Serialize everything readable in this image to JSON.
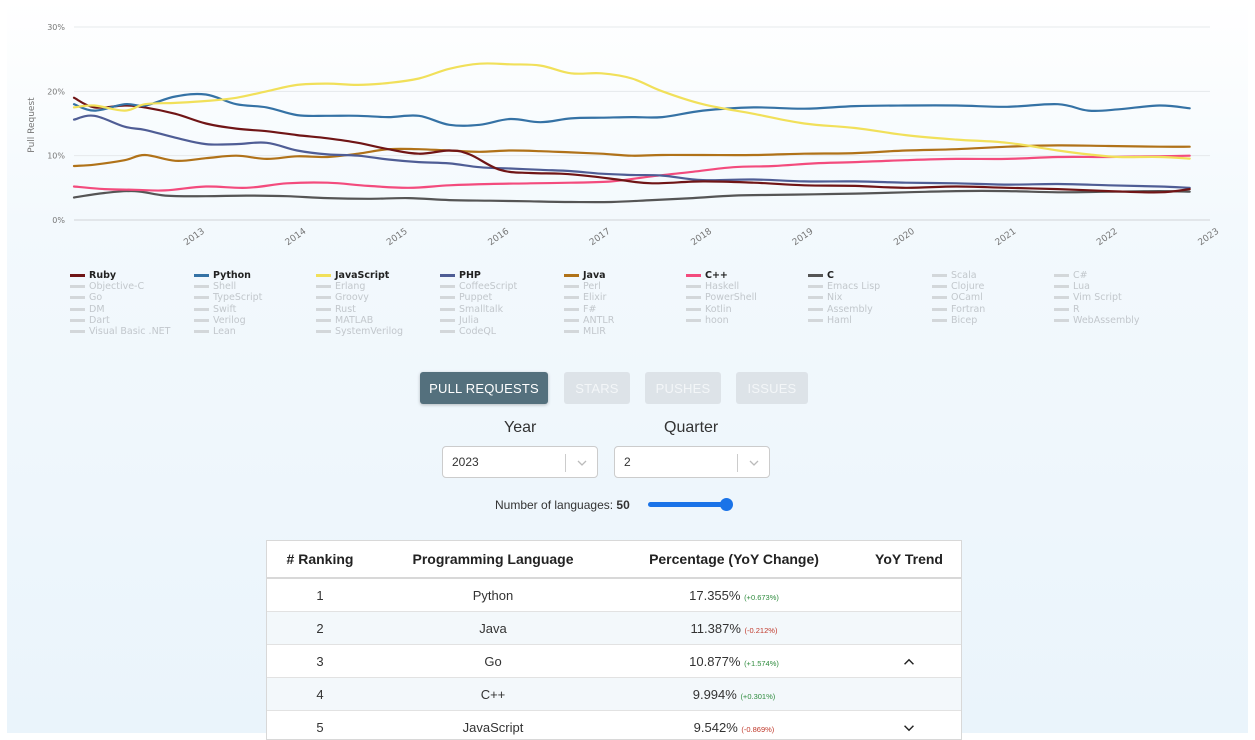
{
  "chart_data": {
    "type": "line",
    "ylabel": "Pull Request",
    "y_ticks": [
      "0%",
      "10%",
      "20%",
      "30%"
    ],
    "ylim": [
      0,
      30
    ],
    "x_ticks": [
      "2013",
      "2014",
      "2015",
      "2016",
      "2017",
      "2018",
      "2019",
      "2020",
      "2021",
      "2022",
      "2023"
    ],
    "x_range": [
      2012.3,
      2023.5
    ],
    "grid": true,
    "legend_position": "bottom",
    "series": [
      {
        "name": "Ruby",
        "color": "#701516",
        "x": [
          2012.3,
          2012.5,
          2012.8,
          2013.0,
          2013.3,
          2013.6,
          2013.9,
          2014.2,
          2014.5,
          2014.8,
          2015.1,
          2015.4,
          2015.7,
          2016.0,
          2016.2,
          2016.5,
          2016.8,
          2017.1,
          2017.4,
          2017.7,
          2018.0,
          2018.5,
          2019.0,
          2019.5,
          2020.0,
          2020.5,
          2021.0,
          2021.5,
          2022.0,
          2022.5,
          2023.0,
          2023.3
        ],
        "y": [
          19.0,
          17.5,
          17.8,
          17.5,
          16.5,
          15.0,
          14.2,
          13.8,
          13.2,
          12.7,
          12.0,
          11.0,
          10.3,
          10.8,
          10.2,
          7.8,
          7.3,
          7.2,
          6.8,
          6.2,
          5.7,
          6.0,
          5.8,
          5.4,
          5.3,
          5.0,
          5.2,
          5.0,
          4.8,
          4.5,
          4.3,
          4.8
        ]
      },
      {
        "name": "Python",
        "color": "#3572A5",
        "x": [
          2012.3,
          2012.5,
          2012.8,
          2013.0,
          2013.3,
          2013.6,
          2013.9,
          2014.2,
          2014.5,
          2014.8,
          2015.1,
          2015.4,
          2015.7,
          2016.0,
          2016.3,
          2016.6,
          2016.9,
          2017.2,
          2017.5,
          2017.8,
          2018.1,
          2018.5,
          2019.0,
          2019.5,
          2020.0,
          2020.5,
          2021.0,
          2021.5,
          2022.0,
          2022.3,
          2022.6,
          2023.0,
          2023.3
        ],
        "y": [
          18.0,
          17.0,
          18.0,
          17.8,
          19.2,
          19.5,
          18.0,
          17.5,
          16.3,
          16.2,
          16.2,
          16.0,
          16.2,
          14.8,
          14.8,
          15.7,
          15.2,
          15.8,
          15.9,
          16.0,
          16.0,
          17.0,
          17.5,
          17.3,
          17.7,
          17.8,
          17.8,
          17.6,
          18.0,
          17.0,
          17.2,
          17.8,
          17.355
        ]
      },
      {
        "name": "JavaScript",
        "color": "#f1e05a",
        "x": [
          2012.3,
          2012.5,
          2012.8,
          2013.0,
          2013.3,
          2013.6,
          2013.9,
          2014.2,
          2014.5,
          2014.8,
          2015.1,
          2015.4,
          2015.7,
          2016.0,
          2016.3,
          2016.6,
          2016.9,
          2017.2,
          2017.5,
          2017.8,
          2018.1,
          2018.5,
          2019.0,
          2019.5,
          2020.0,
          2020.5,
          2021.0,
          2021.5,
          2022.0,
          2022.3,
          2022.6,
          2023.0,
          2023.3
        ],
        "y": [
          17.5,
          17.8,
          17.0,
          18.0,
          18.2,
          18.5,
          19.0,
          20.0,
          21.0,
          21.2,
          21.0,
          21.3,
          22.0,
          23.5,
          24.3,
          24.2,
          24.0,
          22.8,
          22.8,
          22.0,
          20.0,
          18.0,
          16.5,
          15.0,
          14.3,
          13.2,
          12.5,
          12.0,
          10.8,
          10.2,
          9.8,
          9.8,
          9.542
        ]
      },
      {
        "name": "PHP",
        "color": "#4F5D95",
        "x": [
          2012.3,
          2012.5,
          2012.8,
          2013.0,
          2013.3,
          2013.6,
          2013.9,
          2014.2,
          2014.5,
          2014.8,
          2015.1,
          2015.4,
          2015.7,
          2016.0,
          2016.3,
          2016.6,
          2016.9,
          2017.2,
          2017.5,
          2017.8,
          2018.1,
          2018.5,
          2019.0,
          2019.5,
          2020.0,
          2020.5,
          2021.0,
          2021.5,
          2022.0,
          2022.5,
          2023.0,
          2023.3
        ],
        "y": [
          15.6,
          16.2,
          14.5,
          14.0,
          12.8,
          11.8,
          11.8,
          12.0,
          10.8,
          10.2,
          10.0,
          9.4,
          9.0,
          8.8,
          8.2,
          8.0,
          7.8,
          7.6,
          7.2,
          7.0,
          6.9,
          6.2,
          6.3,
          6.0,
          6.0,
          5.8,
          5.7,
          5.5,
          5.6,
          5.4,
          5.2,
          5.0
        ]
      },
      {
        "name": "Java",
        "color": "#b07219",
        "x": [
          2012.3,
          2012.5,
          2012.8,
          2013.0,
          2013.3,
          2013.6,
          2013.9,
          2014.2,
          2014.5,
          2014.8,
          2015.1,
          2015.4,
          2015.7,
          2016.0,
          2016.3,
          2016.6,
          2016.9,
          2017.2,
          2017.5,
          2017.8,
          2018.1,
          2018.5,
          2019.0,
          2019.5,
          2020.0,
          2020.5,
          2021.0,
          2021.5,
          2022.0,
          2022.5,
          2023.0,
          2023.3
        ],
        "y": [
          8.4,
          8.6,
          9.3,
          10.1,
          9.2,
          9.6,
          10.0,
          9.5,
          9.9,
          9.8,
          10.3,
          11.0,
          11.0,
          10.8,
          10.6,
          10.8,
          10.7,
          10.5,
          10.3,
          10.0,
          10.1,
          10.1,
          10.1,
          10.3,
          10.4,
          10.8,
          11.0,
          11.4,
          11.6,
          11.5,
          11.4,
          11.387
        ]
      },
      {
        "name": "C++",
        "color": "#f34b7d",
        "x": [
          2012.3,
          2012.6,
          2012.9,
          2013.2,
          2013.6,
          2014.0,
          2014.4,
          2014.8,
          2015.2,
          2015.6,
          2016.0,
          2016.4,
          2016.8,
          2017.2,
          2017.6,
          2018.0,
          2018.4,
          2018.8,
          2019.2,
          2019.6,
          2020.0,
          2020.5,
          2021.0,
          2021.5,
          2022.0,
          2022.5,
          2023.0,
          2023.3
        ],
        "y": [
          5.2,
          4.8,
          4.7,
          4.6,
          5.2,
          5.0,
          5.7,
          5.8,
          5.3,
          5.0,
          5.4,
          5.6,
          5.7,
          5.8,
          6.0,
          6.8,
          7.5,
          8.2,
          8.4,
          8.8,
          9.0,
          9.3,
          9.5,
          9.5,
          9.8,
          9.8,
          9.9,
          9.994
        ]
      },
      {
        "name": "C",
        "color": "#555555",
        "x": [
          2012.3,
          2012.6,
          2012.9,
          2013.2,
          2013.6,
          2014.0,
          2014.4,
          2014.8,
          2015.2,
          2015.6,
          2016.0,
          2016.4,
          2016.8,
          2017.2,
          2017.6,
          2018.0,
          2018.4,
          2018.8,
          2019.2,
          2019.6,
          2020.0,
          2020.5,
          2021.0,
          2021.5,
          2022.0,
          2022.5,
          2023.0,
          2023.3
        ],
        "y": [
          3.5,
          4.2,
          4.5,
          3.8,
          3.7,
          3.8,
          3.7,
          3.4,
          3.3,
          3.4,
          3.1,
          3.0,
          2.9,
          2.8,
          2.8,
          3.1,
          3.4,
          3.8,
          3.9,
          4.0,
          4.1,
          4.3,
          4.5,
          4.5,
          4.3,
          4.4,
          4.5,
          4.4
        ]
      }
    ]
  },
  "legend": {
    "active": [
      {
        "label": "Ruby",
        "color": "#701516"
      },
      {
        "label": "Python",
        "color": "#3572A5"
      },
      {
        "label": "JavaScript",
        "color": "#f1e05a"
      },
      {
        "label": "PHP",
        "color": "#4F5D95"
      },
      {
        "label": "Java",
        "color": "#b07219"
      },
      {
        "label": "C++",
        "color": "#f34b7d"
      },
      {
        "label": "C",
        "color": "#555555"
      },
      {
        "label": "Scala",
        "color": ""
      },
      {
        "label": "C#",
        "color": ""
      }
    ],
    "inactive_rows": [
      [
        "Objective-C",
        "Shell",
        "Erlang",
        "CoffeeScript",
        "Perl",
        "Haskell",
        "Emacs Lisp",
        "Clojure",
        "Lua"
      ],
      [
        "Go",
        "TypeScript",
        "Groovy",
        "Puppet",
        "Elixir",
        "PowerShell",
        "Nix",
        "OCaml",
        "Vim Script"
      ],
      [
        "DM",
        "Swift",
        "Rust",
        "Smalltalk",
        "F#",
        "Kotlin",
        "Assembly",
        "Fortran",
        "R"
      ],
      [
        "Dart",
        "Verilog",
        "MATLAB",
        "Julia",
        "ANTLR",
        "hoon",
        "Haml",
        "Bicep",
        "WebAssembly"
      ],
      [
        "Visual Basic .NET",
        "Lean",
        "SystemVerilog",
        "CodeQL",
        "MLIR"
      ]
    ]
  },
  "metric_buttons": [
    {
      "label": "PULL REQUESTS",
      "active": true
    },
    {
      "label": "STARS",
      "active": false
    },
    {
      "label": "PUSHES",
      "active": false
    },
    {
      "label": "ISSUES",
      "active": false
    }
  ],
  "filters": {
    "year_label": "Year",
    "year_value": "2023",
    "quarter_label": "Quarter",
    "quarter_value": "2",
    "languages_label": "Number of languages:",
    "languages_value": "50",
    "languages_slider_level": 1.0
  },
  "table": {
    "headers": [
      "# Ranking",
      "Programming Language",
      "Percentage (YoY Change)",
      "YoY Trend"
    ],
    "rows": [
      {
        "rank": "1",
        "language": "Python",
        "percent": "17.355%",
        "change": "(+0.673%)",
        "change_dir": "pos",
        "trend": ""
      },
      {
        "rank": "2",
        "language": "Java",
        "percent": "11.387%",
        "change": "(-0.212%)",
        "change_dir": "neg",
        "trend": ""
      },
      {
        "rank": "3",
        "language": "Go",
        "percent": "10.877%",
        "change": "(+1.574%)",
        "change_dir": "pos",
        "trend": "chevron-up-icon"
      },
      {
        "rank": "4",
        "language": "C++",
        "percent": "9.994%",
        "change": "(+0.301%)",
        "change_dir": "pos",
        "trend": ""
      },
      {
        "rank": "5",
        "language": "JavaScript",
        "percent": "9.542%",
        "change": "(-0.869%)",
        "change_dir": "neg",
        "trend": "chevron-down-icon"
      }
    ]
  }
}
